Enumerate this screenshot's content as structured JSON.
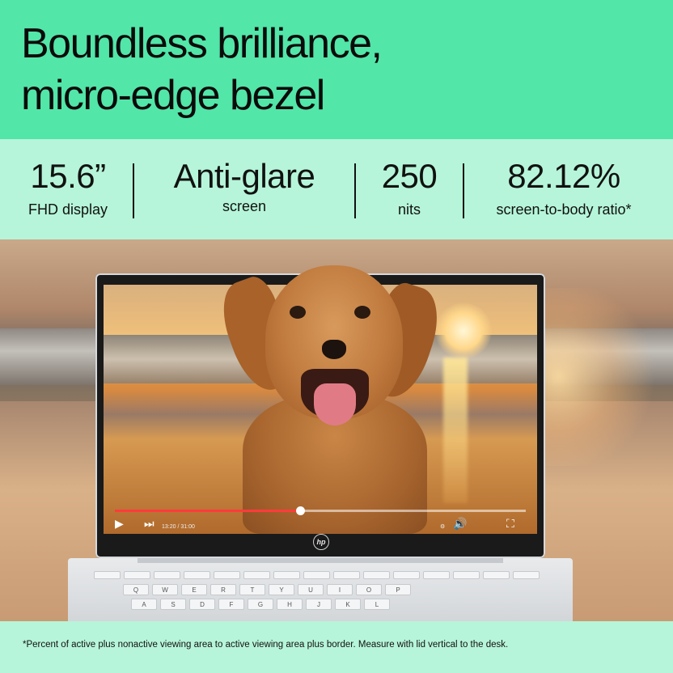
{
  "headline": {
    "line1": "Boundless brilliance,",
    "line2": "micro-edge bezel"
  },
  "specs": [
    {
      "value": "15.6”",
      "label": "FHD display"
    },
    {
      "value": "Anti-glare",
      "label": "screen"
    },
    {
      "value": "250",
      "label": "nits"
    },
    {
      "value": "82.12%",
      "label": "screen-to-body ratio*"
    }
  ],
  "video_player": {
    "progress": 0.45,
    "time": "13:20 / 31:00"
  },
  "brand_logo": "hp",
  "keyboard_rows": [
    [
      "Q",
      "W",
      "E",
      "R",
      "T",
      "Y",
      "U",
      "I",
      "O",
      "P"
    ],
    [
      "A",
      "S",
      "D",
      "F",
      "G",
      "H",
      "J",
      "K",
      "L"
    ]
  ],
  "footnote": "*Percent of active plus nonactive viewing area to active viewing area plus border. Measure with lid vertical to the desk.",
  "colors": {
    "headline_bg": "#52e6a8",
    "specs_bg": "#b6f5d9",
    "progress": "#ff3b3b"
  }
}
